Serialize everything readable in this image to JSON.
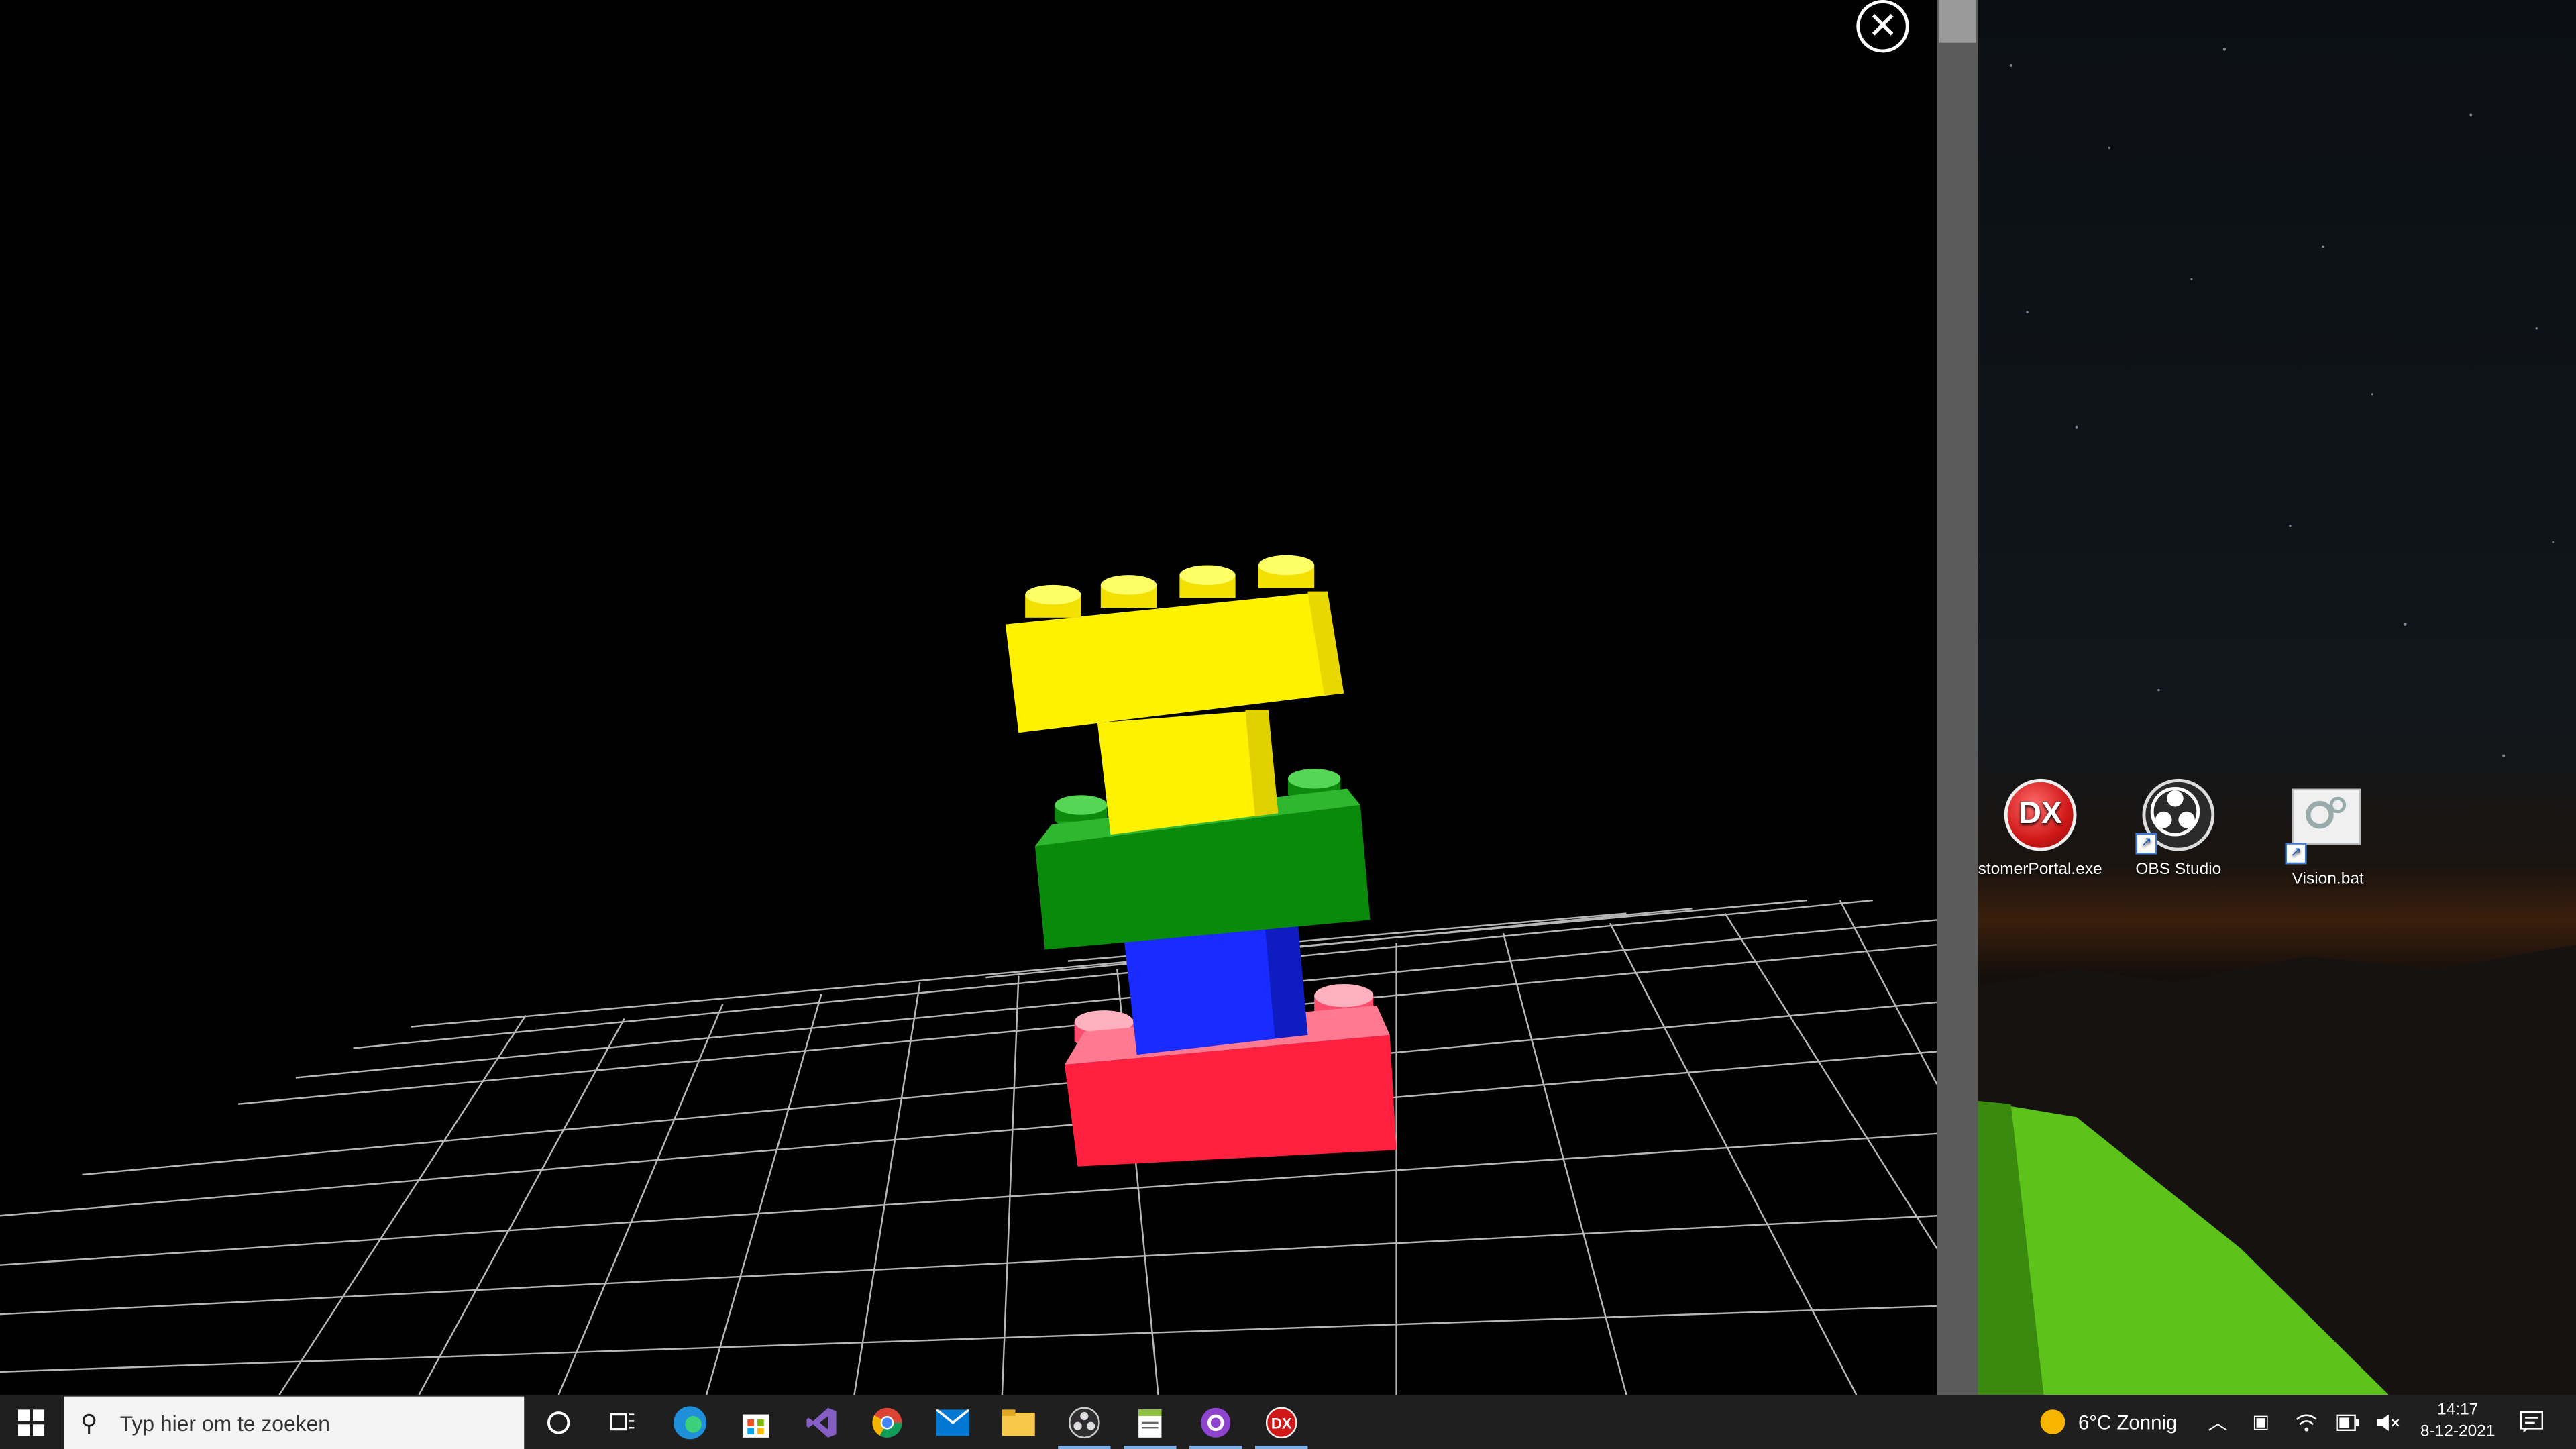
{
  "desktop": {
    "icons": [
      {
        "label": "stomerPortal.exe",
        "icon": "dx-app-icon"
      },
      {
        "label": "OBS Studio",
        "icon": "obs-studio-icon"
      },
      {
        "label": "Vision.bat",
        "icon": "batch-file-icon"
      }
    ]
  },
  "viewer": {
    "close_icon": "close-icon",
    "bricks": [
      "yellow",
      "green",
      "blue",
      "red"
    ],
    "colors": {
      "yellow": "#fff200",
      "green": "#0a8a0a",
      "blue": "#1a2bff",
      "red": "#ff2040"
    }
  },
  "taskbar": {
    "search_placeholder": "Typ hier om te zoeken",
    "apps": [
      "edge-icon",
      "store-icon",
      "visual-studio-icon",
      "chrome-icon",
      "mail-icon",
      "file-explorer-icon",
      "obs-icon",
      "notepad-plus-icon",
      "github-desktop-icon",
      "dx-icon"
    ],
    "weather": "6°C Zonnig",
    "time": "14:17",
    "date": "8-12-2021"
  }
}
